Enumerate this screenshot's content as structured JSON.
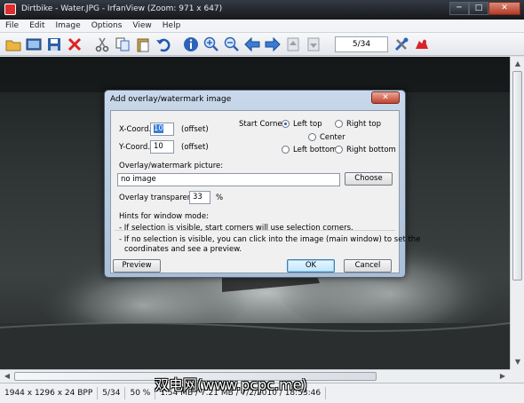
{
  "window": {
    "title": "Dirtbike - Water.JPG - IrfanView (Zoom: 971 x 647)",
    "min": "─",
    "max": "□",
    "close": "✕"
  },
  "menu": [
    "File",
    "Edit",
    "Image",
    "Options",
    "View",
    "Help"
  ],
  "toolbar": {
    "page_indicator": "5/34"
  },
  "statusbar": {
    "cells": [
      "1944 x 1296 x 24 BPP",
      "5/34",
      "50 %",
      "1.54 MB / 7.21 MB / 7/2/2010 / 18:53:46"
    ]
  },
  "watermark": "双电网(www.pcpc.me)",
  "dialog": {
    "title": "Add overlay/watermark image",
    "close": "✕",
    "xcoord_label": "X-Coord.:",
    "xcoord_value": "10",
    "xcoord_unit": "(offset)",
    "ycoord_label": "Y-Coord.:",
    "ycoord_value": "10",
    "ycoord_unit": "(offset)",
    "start_corner_label": "Start Corner:",
    "corners": {
      "left_top": "Left top",
      "right_top": "Right top",
      "center": "Center",
      "left_bottom": "Left bottom",
      "right_bottom": "Right bottom"
    },
    "selected_corner": "left_top",
    "picture_label": "Overlay/watermark picture:",
    "picture_value": "no image",
    "choose_button": "Choose",
    "transparency_label": "Overlay transparency:",
    "transparency_value": "33",
    "transparency_unit": "%",
    "hints_title": "Hints for window mode:",
    "hint1": "- If selection is visible, start corners will use selection corners.",
    "hint2": "- If no selection is visible, you can click into the image (main window) to set the",
    "hint3": "coordinates and see a preview.",
    "preview_button": "Preview",
    "ok_button": "OK",
    "cancel_button": "Cancel"
  }
}
